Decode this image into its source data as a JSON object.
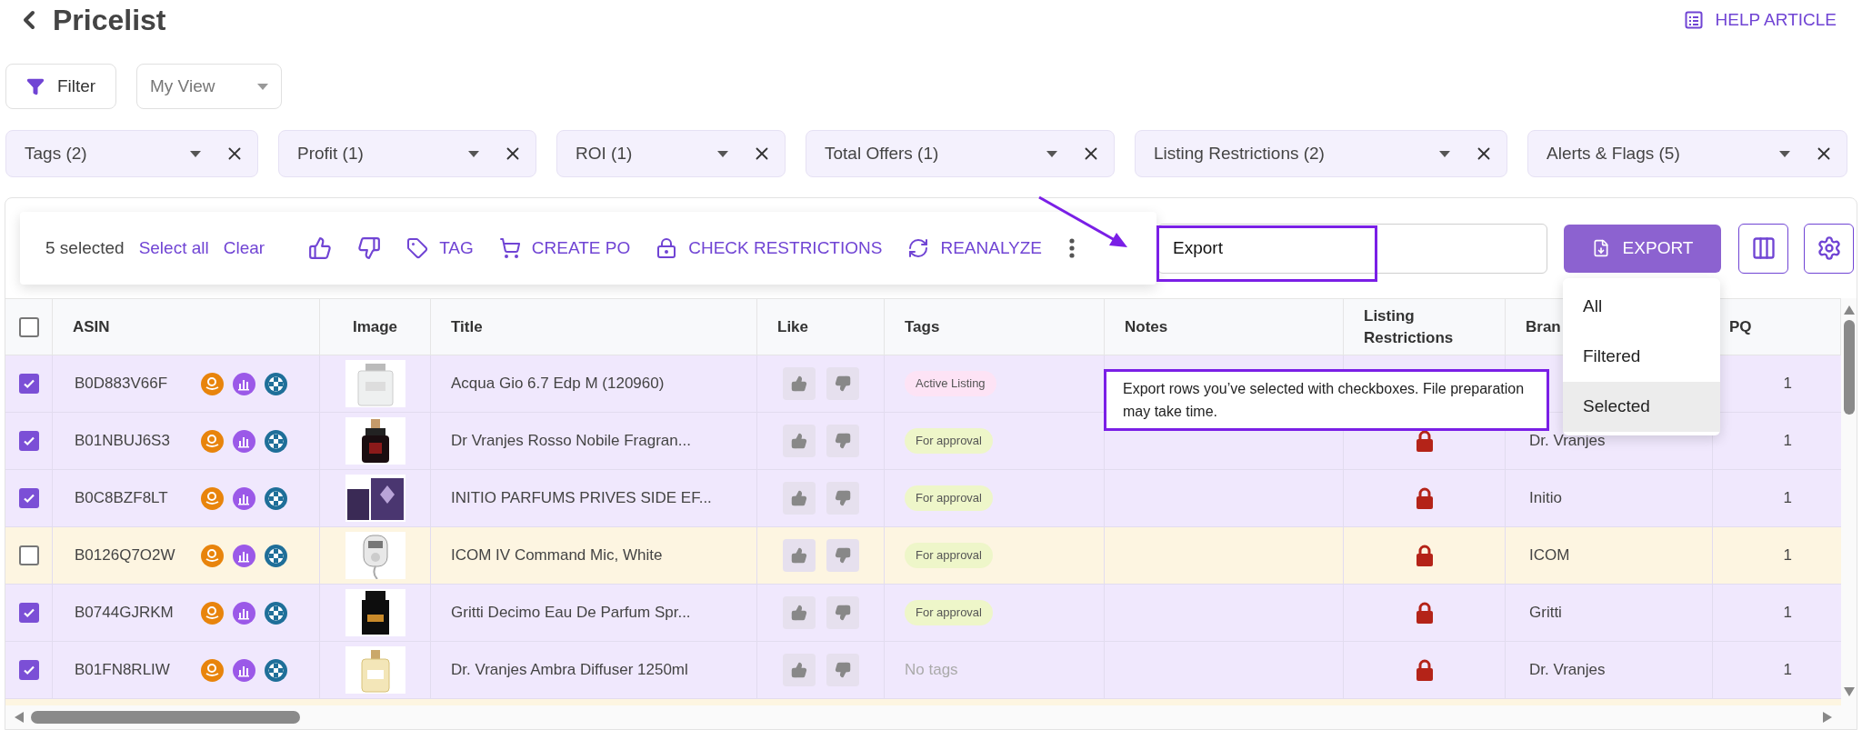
{
  "page": {
    "title": "Pricelist",
    "help_link": "HELP ARTICLE"
  },
  "filter_button": "Filter",
  "view_select": {
    "placeholder": "My View"
  },
  "filter_chips": [
    {
      "label": "Tags (2)"
    },
    {
      "label": "Profit (1)"
    },
    {
      "label": "ROI (1)"
    },
    {
      "label": "Total Offers (1)"
    },
    {
      "label": "Listing Restrictions (2)"
    },
    {
      "label": "Alerts & Flags (5)"
    }
  ],
  "toolbar": {
    "selected_count": "5 selected",
    "select_all": "Select all",
    "clear": "Clear",
    "actions": [
      {
        "kind": "like"
      },
      {
        "kind": "dislike"
      },
      {
        "kind": "tag",
        "label": "TAG"
      },
      {
        "kind": "cart",
        "label": "CREATE PO"
      },
      {
        "kind": "lock",
        "label": "CHECK RESTRICTIONS"
      },
      {
        "kind": "refresh",
        "label": "REANALYZE"
      }
    ]
  },
  "search": {
    "value": "Export"
  },
  "export_button": "EXPORT",
  "export_menu": [
    {
      "label": "All",
      "selected": false
    },
    {
      "label": "Filtered",
      "selected": false
    },
    {
      "label": "Selected",
      "selected": true
    }
  ],
  "tooltip": "Export rows you’ve selected with checkboxes. File preparation may take time.",
  "table": {
    "select_all_checked": false,
    "columns": [
      "ASIN",
      "Image",
      "Title",
      "Like",
      "Tags",
      "Notes",
      "Listing Restrictions",
      "Bran",
      "PQ"
    ],
    "rows": [
      {
        "checked": true,
        "asin": "B0D883V66F",
        "title": "Acqua Gio 6.7 Edp M (120960)",
        "tag": {
          "label": "Active Listing",
          "color": "#fde3f5"
        },
        "pq": "1"
      },
      {
        "checked": true,
        "asin": "B01NBUJ6S3",
        "title": "Dr Vranjes Rosso Nobile Fragran...",
        "tag": {
          "label": "For approval",
          "color": "#eef6c9"
        },
        "restricted": true,
        "brand": "Dr. Vranjes",
        "pq": "1"
      },
      {
        "checked": true,
        "asin": "B0C8BZF8LT",
        "title": "INITIO PARFUMS PRIVES SIDE EF...",
        "tag": {
          "label": "For approval",
          "color": "#eef6c9"
        },
        "restricted": true,
        "brand": "Initio",
        "pq": "1"
      },
      {
        "checked": false,
        "asin": "B0126Q7O2W",
        "title": "ICOM IV Command Mic, White",
        "tag": {
          "label": "For approval",
          "color": "#eef6c9"
        },
        "restricted": true,
        "brand": "ICOM",
        "pq": "1"
      },
      {
        "checked": true,
        "asin": "B0744GJRKM",
        "title": "Gritti Decimo Eau De Parfum Spr...",
        "tag": {
          "label": "For approval",
          "color": "#eef6c9"
        },
        "restricted": true,
        "brand": "Gritti",
        "pq": "1"
      },
      {
        "checked": true,
        "asin": "B01FN8RLIW",
        "title": "Dr. Vranjes Ambra Diffuser 1250ml",
        "tag_placeholder": "No tags",
        "restricted": true,
        "brand": "Dr. Vranjes",
        "pq": "1"
      }
    ]
  }
}
